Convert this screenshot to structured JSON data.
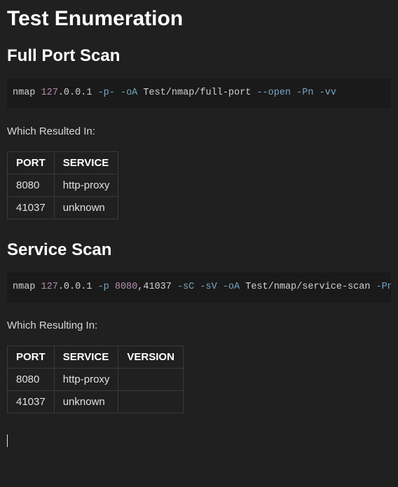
{
  "title": "Test Enumeration",
  "sections": [
    {
      "heading": "Full Port Scan",
      "code_tokens": [
        {
          "t": "nmap ",
          "c": "tok-cmd"
        },
        {
          "t": "127",
          "c": "tok-num"
        },
        {
          "t": ".0.0.1 ",
          "c": "tok-ip"
        },
        {
          "t": "-p-",
          "c": "tok-flag"
        },
        {
          "t": " ",
          "c": "tok-cmd"
        },
        {
          "t": "-oA",
          "c": "tok-flag"
        },
        {
          "t": " Test/nmap/full-port ",
          "c": "tok-path"
        },
        {
          "t": "--open",
          "c": "tok-flag"
        },
        {
          "t": " ",
          "c": "tok-cmd"
        },
        {
          "t": "-Pn",
          "c": "tok-flag"
        },
        {
          "t": " ",
          "c": "tok-cmd"
        },
        {
          "t": "-vv",
          "c": "tok-flag"
        }
      ],
      "note": "Which Resulted In:",
      "table": {
        "headers": [
          "PORT",
          "SERVICE"
        ],
        "rows": [
          [
            "8080",
            "http-proxy"
          ],
          [
            "41037",
            "unknown"
          ]
        ]
      }
    },
    {
      "heading": "Service Scan",
      "code_tokens": [
        {
          "t": "nmap ",
          "c": "tok-cmd"
        },
        {
          "t": "127",
          "c": "tok-num"
        },
        {
          "t": ".0.0.1 ",
          "c": "tok-ip"
        },
        {
          "t": "-p",
          "c": "tok-flag"
        },
        {
          "t": " ",
          "c": "tok-cmd"
        },
        {
          "t": "8080",
          "c": "tok-num"
        },
        {
          "t": ",41037 ",
          "c": "tok-ip"
        },
        {
          "t": "-sC",
          "c": "tok-flag"
        },
        {
          "t": " ",
          "c": "tok-cmd"
        },
        {
          "t": "-sV",
          "c": "tok-flag"
        },
        {
          "t": " ",
          "c": "tok-cmd"
        },
        {
          "t": "-oA",
          "c": "tok-flag"
        },
        {
          "t": " Test/nmap/service-scan ",
          "c": "tok-path"
        },
        {
          "t": "-Pn",
          "c": "tok-flag"
        }
      ],
      "note": "Which Resulting In:",
      "table": {
        "headers": [
          "PORT",
          "SERVICE",
          "VERSION"
        ],
        "rows": [
          [
            "8080",
            "http-proxy",
            ""
          ],
          [
            "41037",
            "unknown",
            ""
          ]
        ]
      }
    }
  ]
}
